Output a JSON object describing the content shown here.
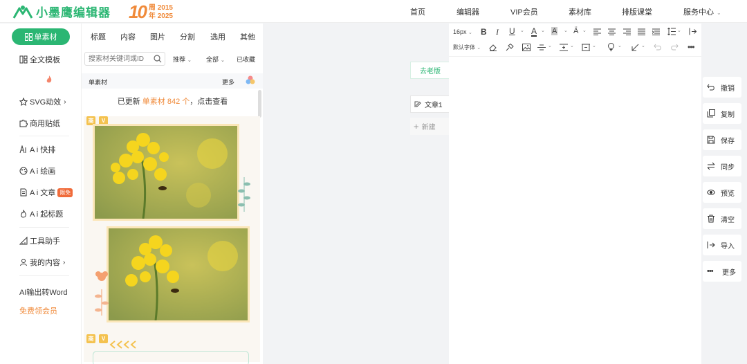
{
  "header": {
    "logo_text": "小墨鹰编辑器",
    "anniv_number": "10",
    "anniv_line1": "周 2015",
    "anniv_line2": "年 2025",
    "nav": [
      {
        "label": "首页",
        "name": "nav-home"
      },
      {
        "label": "编辑器",
        "name": "nav-editor"
      },
      {
        "label": "VIP会员",
        "name": "nav-vip"
      },
      {
        "label": "素材库",
        "name": "nav-materials"
      },
      {
        "label": "排版课堂",
        "name": "nav-classroom"
      },
      {
        "label": "服务中心",
        "name": "nav-service"
      }
    ]
  },
  "sidebar": {
    "active_label": "单素材",
    "items": [
      {
        "label": "全文模板"
      },
      {
        "label": "SVG动效"
      },
      {
        "label": "商用贴纸"
      },
      {
        "label": "A i 快排"
      },
      {
        "label": "A i 绘画"
      },
      {
        "label": "A i 文章"
      },
      {
        "label": "A i 起标题"
      },
      {
        "label": "工具助手"
      },
      {
        "label": "我的内容"
      },
      {
        "label": "AI输出转Word"
      },
      {
        "label": "免费领会员"
      }
    ],
    "new_badge": "限免"
  },
  "panel": {
    "tabs": [
      "标题",
      "内容",
      "图片",
      "分割",
      "选用",
      "其他"
    ],
    "search_placeholder": "搜索材关键词或ID",
    "filters": [
      "推荐",
      "全部",
      "已收藏"
    ],
    "sub_left": "单素材",
    "sub_right": "更多",
    "update_prefix": "已更新",
    "update_highlight": "单素材 842 个",
    "update_suffix": "，点击查看",
    "tag_shang": "商",
    "tag_v": "V"
  },
  "canvas": {
    "old_version_label": "去老版",
    "doc_label": "文章1",
    "new_doc_label": "新建"
  },
  "editor": {
    "font_size": "16px",
    "default_font": "默认字体"
  },
  "actions": [
    {
      "label": "撤销",
      "icon": "undo-icon"
    },
    {
      "label": "复制",
      "icon": "copy-icon"
    },
    {
      "label": "保存",
      "icon": "save-icon"
    },
    {
      "label": "同步",
      "icon": "sync-icon"
    },
    {
      "label": "预览",
      "icon": "eye-icon"
    },
    {
      "label": "清空",
      "icon": "trash-icon"
    },
    {
      "label": "导入",
      "icon": "import-icon"
    },
    {
      "label": "更多",
      "icon": "more-icon"
    }
  ],
  "colors": {
    "brand": "#2bb673",
    "accent": "#f08a3a"
  }
}
